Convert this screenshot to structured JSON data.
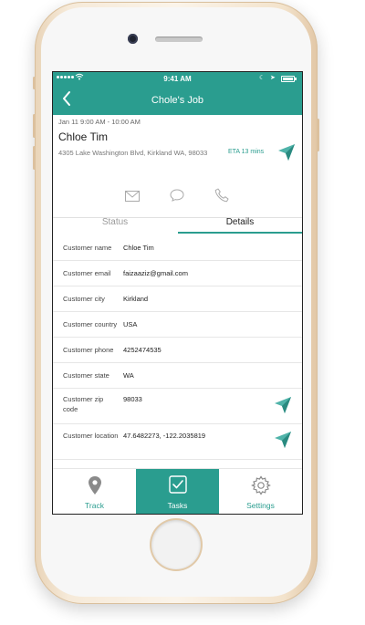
{
  "status_bar": {
    "time": "9:41 AM"
  },
  "nav": {
    "title": "Chole's Job"
  },
  "job": {
    "date_range": "Jan 11 9:00 AM - 10:00 AM",
    "customer_name": "Chloe Tim",
    "address": "4305 Lake Washington Blvd, Kirkland WA, 98033",
    "eta": "ETA 13 mins"
  },
  "tabs": {
    "status": "Status",
    "details": "Details"
  },
  "details": [
    {
      "label": "Customer name",
      "value": "Chloe Tim"
    },
    {
      "label": "Customer email",
      "value": "faizaaziz@gmail.com"
    },
    {
      "label": "Customer city",
      "value": "Kirkland"
    },
    {
      "label": "Customer country",
      "value": "USA"
    },
    {
      "label": "Customer phone",
      "value": "4252474535"
    },
    {
      "label": "Customer state",
      "value": "WA"
    },
    {
      "label": "Customer zip code",
      "value": "98033"
    },
    {
      "label": "Customer location",
      "value": "47.6482273, -122.2035819"
    }
  ],
  "tab_bar": {
    "track": "Track",
    "tasks": "Tasks",
    "settings": "Settings"
  },
  "colors": {
    "accent": "#2a9d8f",
    "arrow": "#4fb3a9"
  },
  "icons": {
    "back": "chevron-left-icon",
    "navigate": "navigation-arrow-icon",
    "mail": "mail-icon",
    "chat": "chat-bubble-icon",
    "phone": "phone-icon",
    "track": "map-pin-icon",
    "tasks": "checkbox-icon",
    "settings": "gear-icon"
  }
}
